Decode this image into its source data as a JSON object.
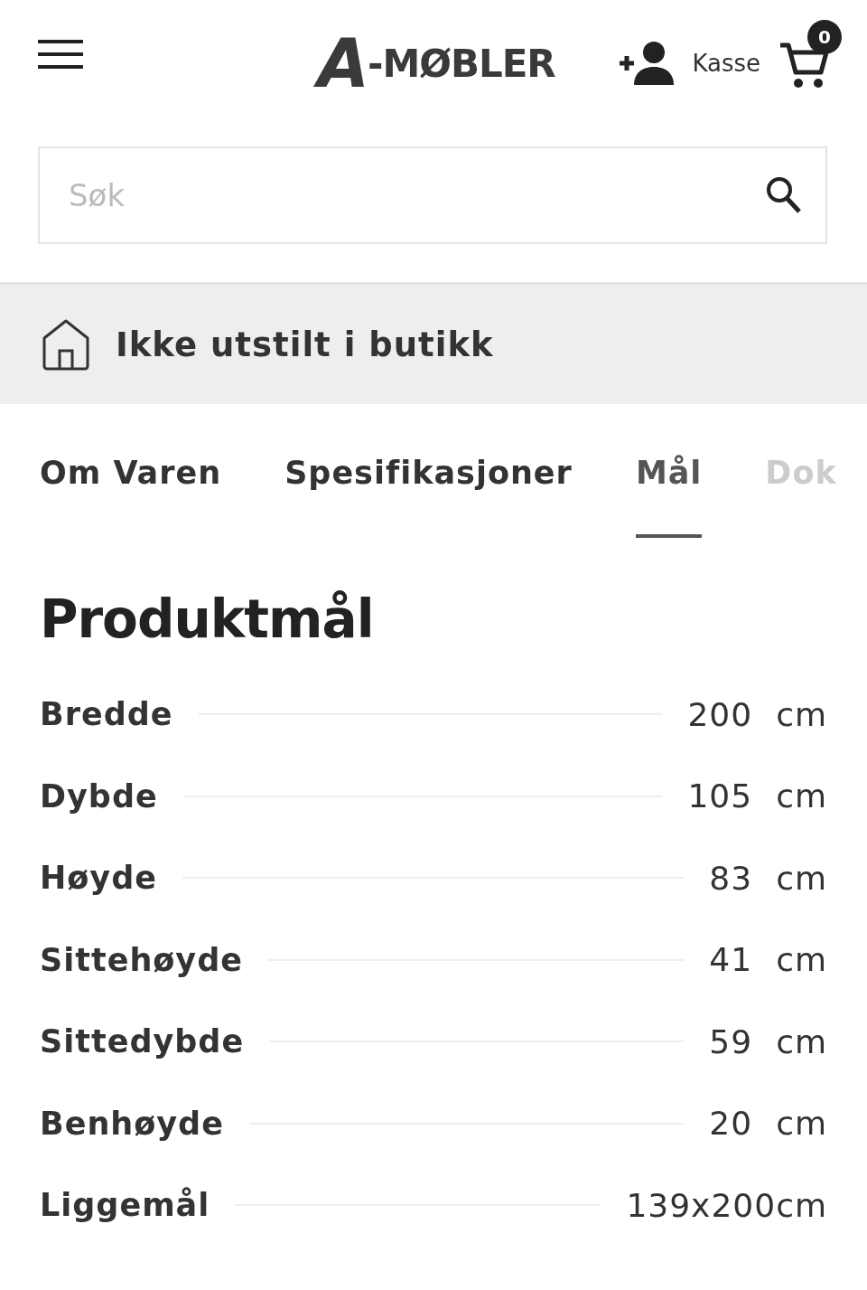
{
  "header": {
    "logo_mark": "A",
    "logo_text": "-MØBLER",
    "checkout_label": "Kasse",
    "cart_count": "0"
  },
  "search": {
    "placeholder": "Søk"
  },
  "banner": {
    "text": "Ikke utstilt i butikk"
  },
  "tabs": [
    {
      "label": "Om Varen",
      "selected": false,
      "faded": false
    },
    {
      "label": "Spesifikasjoner",
      "selected": false,
      "faded": false
    },
    {
      "label": "Mål",
      "selected": true,
      "faded": false
    },
    {
      "label": "Dok",
      "selected": false,
      "faded": true
    }
  ],
  "section": {
    "title": "Produktmål",
    "rows": [
      {
        "label": "Bredde",
        "value": "200",
        "unit": "cm"
      },
      {
        "label": "Dybde",
        "value": "105",
        "unit": "cm"
      },
      {
        "label": "Høyde",
        "value": "83",
        "unit": "cm"
      },
      {
        "label": "Sittehøyde",
        "value": "41",
        "unit": "cm"
      },
      {
        "label": "Sittedybde",
        "value": "59",
        "unit": "cm"
      },
      {
        "label": "Benhøyde",
        "value": "20",
        "unit": "cm"
      },
      {
        "label": "Liggemål",
        "value": "139x200cm"
      }
    ]
  }
}
